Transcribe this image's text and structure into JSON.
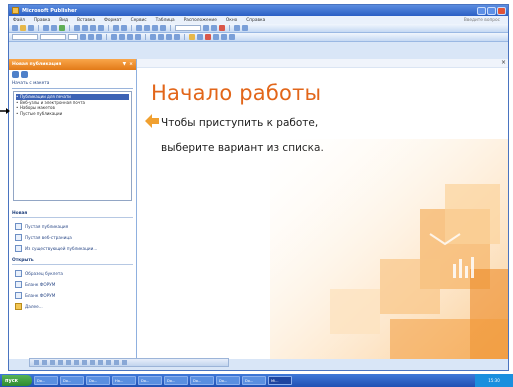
{
  "window": {
    "title": "Microsoft Publisher"
  },
  "menubar": {
    "items": [
      "Файл",
      "Правка",
      "Вид",
      "Вставка",
      "Формат",
      "Сервис",
      "Таблица",
      "Расположение",
      "Окно",
      "Справка"
    ],
    "help_placeholder": "Введите вопрос"
  },
  "taskpane": {
    "header": "Новая публикация",
    "start_from": "Начать с макета",
    "list_items": [
      "Публикации для печати",
      "Веб-узлы и электронная почта",
      "Наборы макетов",
      "Пустые публикации"
    ],
    "new_title": "Новая",
    "new_links": [
      "Пустая публикация",
      "Пустая веб-страница",
      "Из существующей публикации..."
    ],
    "open_title": "Открыть",
    "open_links": [
      "Образец буклета",
      "Бланк ФОРУМ",
      "Бланк ФОРУМ",
      "Далее..."
    ]
  },
  "main": {
    "title": "Начало работы",
    "line1": "Чтобы приступить к работе,",
    "line2": "выберите вариант из списка.",
    "title_color": "#e2661a"
  },
  "taskbar": {
    "start_label": "пуск",
    "tasks": [
      "Do...",
      "Do...",
      "Do...",
      "Ha...",
      "Do...",
      "Do...",
      "Do...",
      "Do...",
      "Do...",
      "Mi..."
    ],
    "tray_time": "15:30"
  }
}
